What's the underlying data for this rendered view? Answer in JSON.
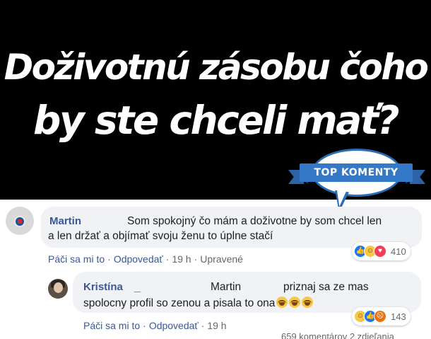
{
  "headline": {
    "line1": "Doživotnú zásobu čoho",
    "line2": "by ste chceli mať?"
  },
  "badge": {
    "label": "TOP KOMENTY"
  },
  "comments": [
    {
      "author": "Martin",
      "text_line1": "Som spokojný čo mám a doživotne by som chcel len",
      "text_line2": "a len držať a objímať svoju ženu to úplne stačí",
      "like": "Páči sa mi to",
      "sep1": "·",
      "reply": "Odpovedať",
      "sep2": "·",
      "time": "19 h",
      "sep3": "·",
      "edited": "Upravené",
      "reactions": [
        "like",
        "haha",
        "love"
      ],
      "reaction_count": "410"
    },
    {
      "author": "Kristína",
      "mention_placeholder": "_",
      "mention": "Martin",
      "text_line1_rest": "priznaj sa ze mas",
      "text_line2": "spolocny profil so zenou a pisala to ona",
      "emojis": [
        "laughing-crying",
        "laughing-crying",
        "laughing-crying"
      ],
      "like": "Páči sa mi to",
      "sep1": "·",
      "reply": "Odpovedať",
      "sep2": "·",
      "time": "19 h",
      "reactions": [
        "haha",
        "like",
        "angry"
      ],
      "reaction_count": "143"
    }
  ],
  "footer": {
    "summary": "659 komentárov  2 zdieľania"
  },
  "colors": {
    "banner": "#000000",
    "badge_blue": "#3479c7",
    "link": "#385898",
    "comment_bg": "#f0f2f5"
  }
}
